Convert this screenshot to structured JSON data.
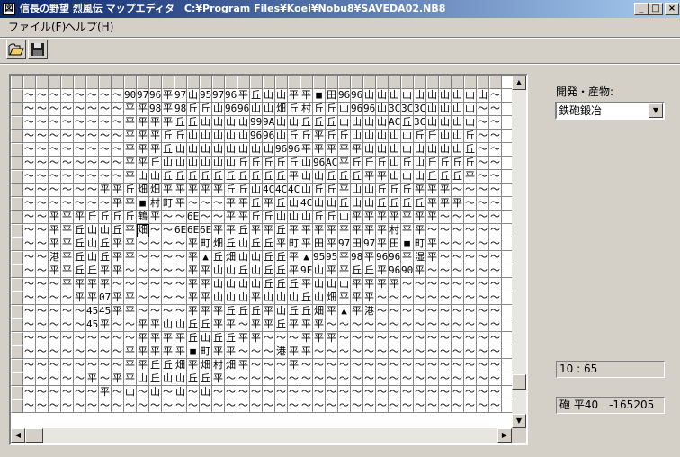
{
  "window": {
    "icon": "koei-app-icon",
    "title": "信長の野望 烈風伝 マップエディタ　C:¥Program Files¥Koei¥Nobu8¥SAVEDA02.NB8",
    "buttons": {
      "minimize": "_",
      "maximize": "□",
      "close": "×"
    }
  },
  "menu": {
    "file": "ファイル(F)",
    "help": "ヘルプ(H)"
  },
  "toolbar": {
    "open_icon": "folder-open-icon",
    "save_icon": "floppy-disk-icon"
  },
  "panel": {
    "label": "開発・産物:",
    "select_value": "鉄砲鍛冶",
    "coords": "10 : 65",
    "info": "砲 平40　-165205"
  },
  "map": {
    "selected": [
      10,
      10
    ],
    "rows": [
      "～～～～～～～～90 97 96 平 97 山 95 97 96 平 丘 山 山 平 平 ■ 田 96 96 山 山 山 山 山 山 山 山 山 山",
      "～～～～～～～～平 平 98 平 98 丘 丘 山 96 96 山 山 畑 丘 村 丘 丘 山 96 96 山 3C 3C 3C 山 山 山 山",
      "～～～～～～～～平 平 平 平 丘 丘 山 山 山 山 99 9A 山 山 丘 丘 丘 山 山 山 山 AC 丘 3C 山 山 山 山",
      "～～～～～～～～平 平 平 丘 丘 山 山 山 山 山 96 96 山 丘 丘 平 丘 丘 山 山 山 山 山 丘 丘 山 山 丘",
      "～～～～～～～～平 平 平 丘 山 山 山 山 山 山 山 山 96 96 平 平 平 平 平 山 山 山 山 山 山 山 山 丘",
      "～～～～～～～～平 平 丘 山 山 山 山 山 山 丘 丘 丘 丘 丘 山 96 AC 平 丘 丘 丘 山 丘 山 丘 丘 丘 丘",
      "～～～～～～～～平 山 山 丘 丘 丘 丘 丘 丘 丘 丘 丘 丘 平 山 山 丘 丘 丘 平 平 山 山 山 丘 丘 丘 平",
      "～～～～～～平 平 丘 畑 畑 平 平 平 平 平 丘 丘 山 4C 4C 4C 山 丘 丘 平 山 山 丘 丘 丘 平 平 平",
      "～～～～～～～平 平 ■ 村 町 平 ～～～平 平 丘 平 丘 山 4C 山 山 丘 山 山 丘 丘 丘 丘 平 平 平",
      "～～平 平 平 丘 丘 丘 丘 鶴 平 ～～6E ～～平 平 丘 丘 山 山 山 丘 丘 山 平 平 平 平 平 平 平",
      "～～平 平 丘 山 山 丘 平 畑 ～～6E 6E 6E 平 平 丘 平 平 丘 平 平 平 平 平 平 平 平 村 平 平",
      "～～平 平 丘 山 丘 平 平 ～～～～平 町 畑 丘 山 丘 丘 平 町 平 田 平 97 田 97 平 田 ■ 町 平",
      "～～港 平 丘 山 丘 平 平 ～～～～平 ▲ 丘 畑 山 山 丘 丘 平 ▲ 95 95 平 98 平 96 96 平 湿 平",
      "～～平 平 丘 丘 平 平 ～～～～～平 平 山 山 丘 山 丘 丘 平 9F 山 平 平 丘 丘 平 96 90 平 ～",
      "～～～平 平 平 平 ～～～～～～平 平 山 山 山 山 丘 丘 丘 平 山 山 山 平 平 平 平 ～～～",
      "～～～～平 平 07 平 平 ～～～～平 平 山 山 山 平 山 山 山 丘 山 畑 平 平 平 ～～～～～",
      "～～～～～45 45 平 平 ～～～～平 平 平 丘 丘 丘 平 山 丘 丘 畑 平 ▲ 平 港 ～～～～～",
      "～～～～～45 平 ～～平 平 山 山 丘 丘 平 平 ～平 平 丘 平 平 平 ～～～～～～～～～",
      "～～～～～～～～～平 平 平 平 丘 山 丘 丘 平 平 ～～～平 平 平 ～～～～～～～～～",
      "～～～～～～～～平 平 平 平 平 ■ 町 平 平 ～～～港 平 平 ～～～～～～～～～～",
      "～～～～～～～～平 平 丘 丘 畑 平 畑 村 畑 平 ～～～平 ～～～～～～～～～～～",
      "～～～～～平 ～平 平 山 丘 山 山 丘 丘 平 ～～～～～～～～～～～～～～～～～",
      "～～～～～～平 ～山 ～山 ～山 ～山 ～～～～～～～～～～～～～～～～～～～",
      "～～～～～～～～～～～～～～～～～～～～～～～～～～～～～～～～～～～～"
    ]
  }
}
